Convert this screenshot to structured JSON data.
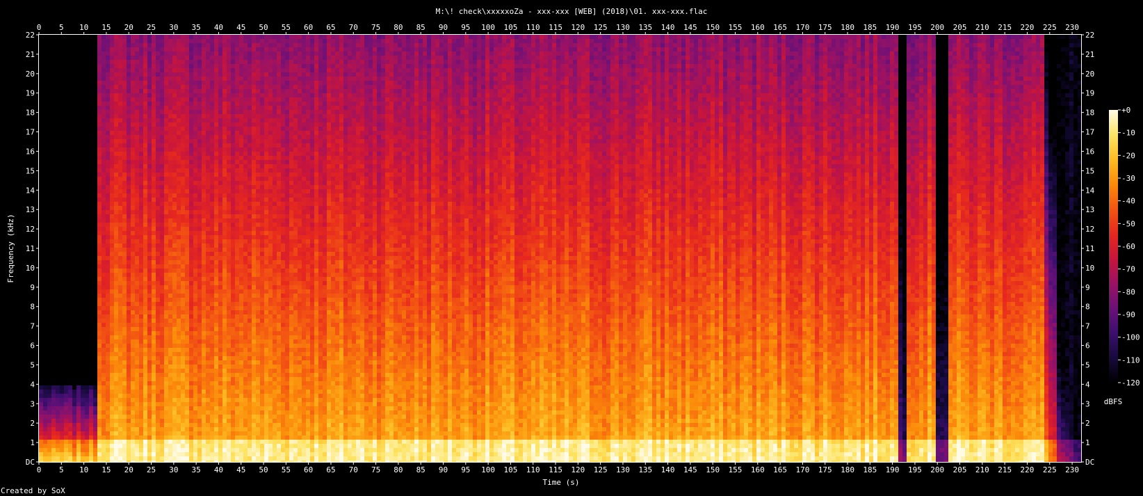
{
  "chart_data": {
    "type": "heatmap",
    "title": "M:\\! check\\xxxxxoZa - xxx-xxx [WEB] (2018)\\01. xxx-xxx.flac",
    "xlabel": "Time (s)",
    "ylabel": "Frequency (kHz)",
    "footer": "Created by SoX",
    "xlim": [
      0,
      232
    ],
    "ylim": [
      0,
      22
    ],
    "x_ticks": [
      0,
      5,
      10,
      15,
      20,
      25,
      30,
      35,
      40,
      45,
      50,
      55,
      60,
      65,
      70,
      75,
      80,
      85,
      90,
      95,
      100,
      105,
      110,
      115,
      120,
      125,
      130,
      135,
      140,
      145,
      150,
      155,
      160,
      165,
      170,
      175,
      180,
      185,
      190,
      195,
      200,
      205,
      210,
      215,
      220,
      225,
      230
    ],
    "y_ticks": [
      "DC",
      "1",
      "2",
      "3",
      "4",
      "5",
      "6",
      "7",
      "8",
      "9",
      "10",
      "11",
      "12",
      "13",
      "14",
      "15",
      "16",
      "17",
      "18",
      "19",
      "20",
      "21",
      "22"
    ],
    "colorbar": {
      "label": "dBFS",
      "range": [
        -120,
        0
      ],
      "ticks": [
        "+0",
        "-10",
        "-20",
        "-30",
        "-40",
        "-50",
        "-60",
        "-70",
        "-80",
        "-90",
        "-100",
        "-110",
        "-120"
      ]
    },
    "colormap": [
      "#000000",
      "#160a3c",
      "#3c0f6e",
      "#6a1178",
      "#9a1264",
      "#c8153c",
      "#e6281e",
      "#f35512",
      "#fb8a0a",
      "#fdbb22",
      "#fde464",
      "#fffbe6"
    ]
  }
}
